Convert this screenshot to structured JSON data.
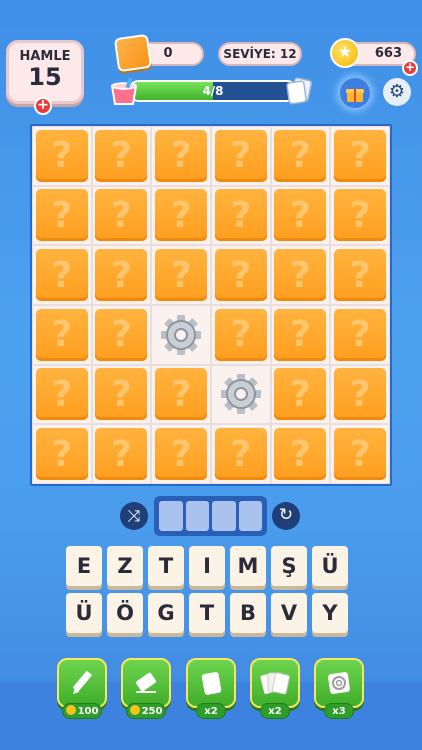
{
  "hud": {
    "moves_label": "HAMLE",
    "moves_value": "15",
    "moves_plus": "+",
    "score_value": "0",
    "level_label": "SEVİYE: 12",
    "coins_value": "663",
    "coins_plus": "+",
    "progress_text": "4/8",
    "progress_fraction": 0.5,
    "icons": [
      "bucket-icon",
      "cards-icon",
      "gift-icon",
      "gear-icon",
      "coin-icon"
    ]
  },
  "board": {
    "rows": 6,
    "cols": 6,
    "tile_glyph": "?",
    "cells": [
      [
        "tile",
        "tile",
        "tile",
        "tile",
        "tile",
        "tile"
      ],
      [
        "tile",
        "tile",
        "tile",
        "tile",
        "tile",
        "tile"
      ],
      [
        "tile",
        "tile",
        "tile",
        "tile",
        "tile",
        "tile"
      ],
      [
        "tile",
        "tile",
        "gear",
        "tile",
        "tile",
        "tile"
      ],
      [
        "tile",
        "tile",
        "tile",
        "gear",
        "tile",
        "tile"
      ],
      [
        "tile",
        "tile",
        "tile",
        "tile",
        "tile",
        "tile"
      ]
    ]
  },
  "answer": {
    "slots": 4,
    "shuffle_icon": "shuffle-icon",
    "refresh_icon": "refresh-icon"
  },
  "keyboard": {
    "row1": [
      "E",
      "Z",
      "T",
      "I",
      "M",
      "Ş",
      "Ü"
    ],
    "row2": [
      "Ü",
      "Ö",
      "G",
      "T",
      "B",
      "V",
      "Y"
    ]
  },
  "tools": [
    {
      "icon": "pencil-icon",
      "tag": "100",
      "has_coin": true
    },
    {
      "icon": "eraser-icon",
      "tag": "250",
      "has_coin": true
    },
    {
      "icon": "card-icon",
      "tag": "x2",
      "has_coin": false
    },
    {
      "icon": "cards-stack-icon",
      "tag": "x2",
      "has_coin": false
    },
    {
      "icon": "target-icon",
      "tag": "x3",
      "has_coin": false
    }
  ],
  "colors": {
    "background": "#4a9cec",
    "tile": "#ff9e1f",
    "tool": "#4fbe37",
    "progress": "#4cc235"
  }
}
